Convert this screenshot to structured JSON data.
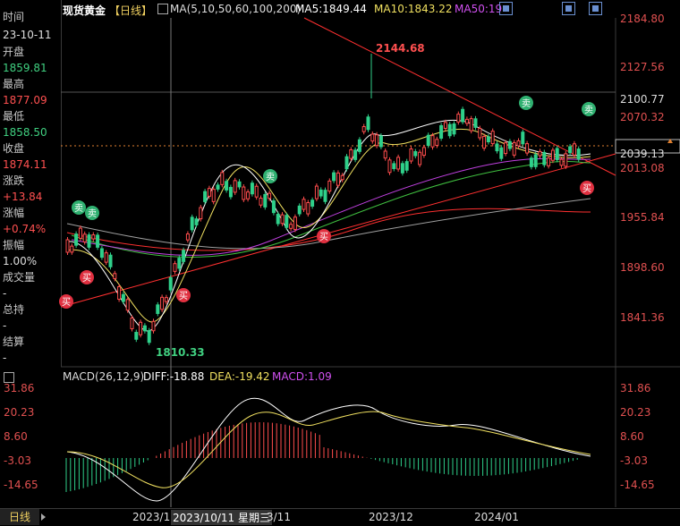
{
  "header": {
    "symbol": "现货黄金",
    "period": "【日线】",
    "ma_params": "MA(5,10,50,60,100,200)",
    "ma5": "MA5:1849.44",
    "ma10": "MA10:1843.22",
    "ma50": "MA50:19"
  },
  "sidebar": {
    "time_label": "时间",
    "time_value": "23-10-11",
    "open_label": "开盘",
    "open_value": "1859.81",
    "high_label": "最高",
    "high_value": "1877.09",
    "low_label": "最低",
    "low_value": "1858.50",
    "close_label": "收盘",
    "close_value": "1874.11",
    "change_label": "涨跌",
    "change_value": "+13.84",
    "pct_label": "涨幅",
    "pct_value": "+0.74%",
    "amp_label": "振幅",
    "amp_value": "1.00%",
    "vol_label": "成交量",
    "vol_value": "-",
    "hold_label": "总持",
    "hold_value": "-",
    "settle_label": "结算",
    "settle_value": "-"
  },
  "price_axis": [
    "2184.80",
    "2127.56",
    "2100.77",
    "2070.32",
    "2039.13",
    "2013.08",
    "1955.84",
    "1898.60",
    "1841.36"
  ],
  "annotations": {
    "high_mark": "2144.68",
    "low_mark": "1810.33",
    "buy": "买",
    "sell": "卖"
  },
  "macd": {
    "title": "MACD(26,12,9)",
    "diff": "DIFF:-18.88",
    "dea": "DEA:-19.42",
    "macd": "MACD:1.09",
    "axis": [
      "31.86",
      "20.23",
      "8.60",
      "-3.03",
      "-14.65"
    ]
  },
  "bottom": {
    "period_tab": "日线",
    "date1": "2023/1(",
    "cursor_date": "2023/10/11 星期三",
    "date2": "3/11",
    "date3": "2023/12",
    "date4": "2024/01"
  },
  "colors": {
    "up": "#ff4d4d",
    "down": "#2fd08a",
    "ma5": "#ffffff",
    "ma10": "#f0e060",
    "ma50": "#c040e0",
    "ma60": "#40c040",
    "ma100": "#a0a0a0",
    "ma200": "#ff3030"
  }
}
